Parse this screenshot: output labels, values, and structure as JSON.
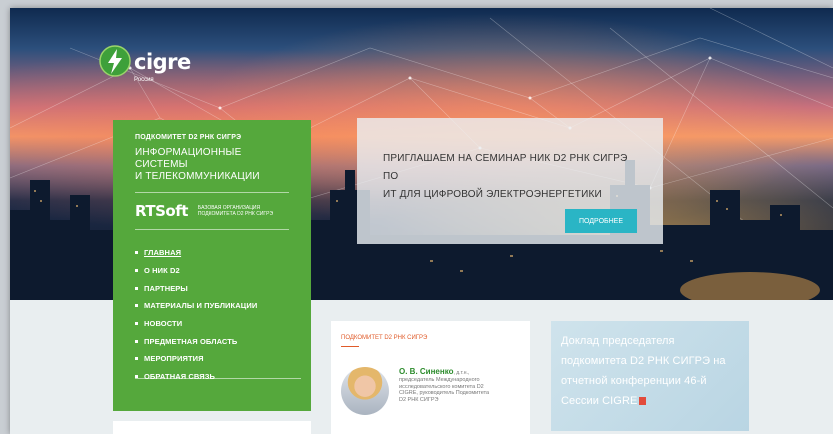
{
  "logo": {
    "name": "cigre",
    "subtitle": "Россия",
    "icon": "cigre-globe-icon"
  },
  "sidebar": {
    "kicker": "ПОДКОМИТЕТ D2 РНК СИГРЭ",
    "title_line1": "ИНФОРМАЦИОННЫЕ СИСТЕМЫ",
    "title_line2": "И ТЕЛЕКОММУНИКАЦИИ",
    "partner_logo": "RTSoft",
    "partner_sub_line1": "БАЗОВАЯ ОРГАНИЗАЦИЯ",
    "partner_sub_line2": "ПОДКОМИТЕТА D2 РНК СИГРЭ",
    "nav": [
      {
        "label": "ГЛАВНАЯ"
      },
      {
        "label": "О НИК D2"
      },
      {
        "label": "ПАРТНЕРЫ"
      },
      {
        "label": "МАТЕРИАЛЫ И ПУБЛИКАЦИИ"
      },
      {
        "label": "НОВОСТИ"
      },
      {
        "label": "ПРЕДМЕТНАЯ ОБЛАСТЬ"
      },
      {
        "label": "МЕРОПРИЯТИЯ"
      },
      {
        "label": "ОБРАТНАЯ СВЯЗЬ"
      }
    ]
  },
  "banner": {
    "line1": "ПРИГЛАШАЕМ НА СЕМИНАР НИК D2 РНК СИГРЭ ПО",
    "line2": "ИТ ДЛЯ ЦИФРОВОЙ ЭЛЕКТРОЭНЕРГЕТИКИ",
    "button": "ПОДРОБНЕЕ"
  },
  "card_mid": {
    "kicker": "ПОДКОМИТЕТ D2 РНК СИГРЭ",
    "name": "О. В. Синенко",
    "degree": ", д.т.н.,",
    "desc_line1": "председатель Международного",
    "desc_line2": "исследовательского комитета D2",
    "desc_line3": "CIGRE, руководитель Подкомитета",
    "desc_line4": "D2 РНК СИГРЭ"
  },
  "card_right": {
    "line1": "Доклад председателя",
    "line2": "подкомитета D2 РНК СИГРЭ на",
    "line3": "отчетной конференции 46-й",
    "line4": "Сессии CIGRE",
    "icon": "pdf-icon"
  },
  "colors": {
    "green": "#55a83c",
    "button": "#2ab5c5",
    "accent_orange": "#e05b2a",
    "name_green": "#2d8c2d"
  }
}
